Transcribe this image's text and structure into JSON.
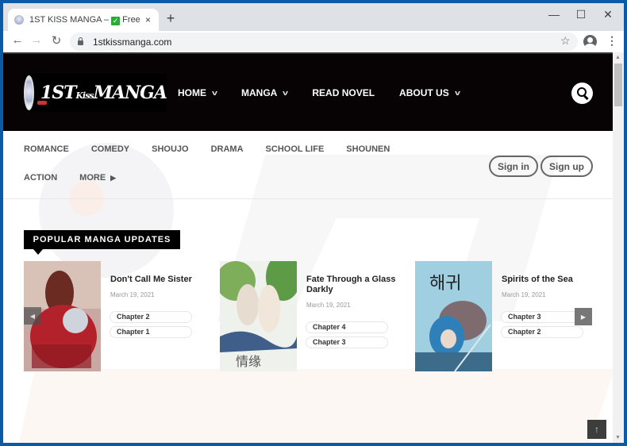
{
  "browser": {
    "tab": {
      "title_prefix": "1ST KISS MANGA – ",
      "title_check": "✓",
      "title_suffix": " Free onli",
      "close": "×"
    },
    "new_tab": "+",
    "window_controls": {
      "minimize": "—",
      "maximize": "☐",
      "close": "✕"
    },
    "nav": {
      "back": "←",
      "forward": "→",
      "reload": "↻"
    },
    "url": "1stkissmanga.com",
    "bookmark_star": "☆",
    "menu": "⋮"
  },
  "site": {
    "logo": {
      "main": "1ST",
      "kiss": "Kiss",
      "manga": "MANGA"
    },
    "main_nav": [
      {
        "label": "HOME",
        "has_dropdown": true
      },
      {
        "label": "MANGA",
        "has_dropdown": true
      },
      {
        "label": "READ NOVEL",
        "has_dropdown": false
      },
      {
        "label": "ABOUT US",
        "has_dropdown": true
      }
    ],
    "dropdown_glyph": "v",
    "categories_row1": [
      "ROMANCE",
      "COMEDY",
      "SHOUJO",
      "DRAMA",
      "SCHOOL LIFE",
      "SHOUNEN"
    ],
    "categories_row2": [
      "ACTION",
      "MORE"
    ],
    "more_glyph": "▶",
    "auth": {
      "sign_in": "Sign in",
      "sign_up": "Sign up"
    },
    "section_title": "POPULAR MANGA UPDATES",
    "manga": [
      {
        "title": "Don't Call Me Sister",
        "date": "March 19, 2021",
        "chapters": [
          "Chapter 2",
          "Chapter 1"
        ]
      },
      {
        "title": "Fate Through a Glass Darkly",
        "date": "March 19, 2021",
        "chapters": [
          "Chapter 4",
          "Chapter 3"
        ]
      },
      {
        "title": "Spirits of the Sea",
        "date": "March 19, 2021",
        "chapters": [
          "Chapter 3",
          "Chapter 2"
        ]
      }
    ],
    "slider": {
      "prev": "◀",
      "next": "▶"
    },
    "back_to_top": "↑"
  },
  "colors": {
    "header_bg": "#070203",
    "frame_blue": "#0a5aa8",
    "watermark": "#f5f5f5"
  }
}
